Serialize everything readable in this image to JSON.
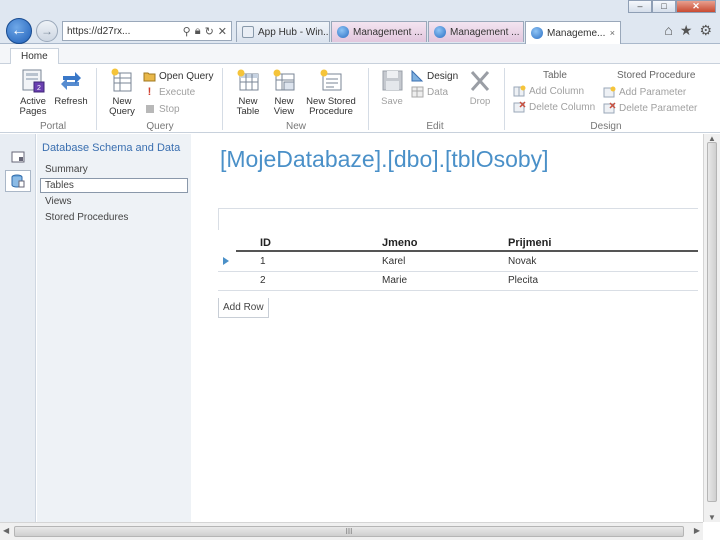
{
  "browser": {
    "address": "https://d27rx...",
    "tabs": [
      {
        "label": "App Hub - Win..."
      },
      {
        "label": "Management ..."
      },
      {
        "label": "Management ..."
      },
      {
        "label": "Manageme..."
      }
    ],
    "close_glyph": "×"
  },
  "ribbon": {
    "tab_home": "Home",
    "portal": {
      "active_pages": "Active\nPages",
      "refresh": "Refresh",
      "group": "Portal"
    },
    "query": {
      "new_query": "New\nQuery",
      "open_query": "Open Query",
      "execute": "Execute",
      "stop": "Stop",
      "group": "Query"
    },
    "new": {
      "new_table": "New\nTable",
      "new_view": "New\nView",
      "new_sp": "New Stored\nProcedure",
      "group": "New"
    },
    "edit": {
      "save": "Save",
      "design": "Design",
      "data": "Data",
      "drop": "Drop",
      "group": "Edit"
    },
    "design": {
      "table_head": "Table",
      "add_column": "Add Column",
      "delete_column": "Delete Column",
      "sp_head": "Stored Procedure",
      "add_parameter": "Add Parameter",
      "delete_parameter": "Delete Parameter",
      "group": "Design"
    }
  },
  "nav": {
    "heading": "Database Schema and Data",
    "items": [
      "Summary",
      "Tables",
      "Views",
      "Stored Procedures"
    ]
  },
  "main": {
    "title": "[MojeDatabaze].[dbo].[tblOsoby]",
    "columns": [
      "ID",
      "Jmeno",
      "Prijmeni"
    ],
    "rows": [
      [
        "1",
        "Karel",
        "Novak"
      ],
      [
        "2",
        "Marie",
        "Plecita"
      ]
    ],
    "add_row": "Add Row"
  },
  "hscroll_grip": "III"
}
